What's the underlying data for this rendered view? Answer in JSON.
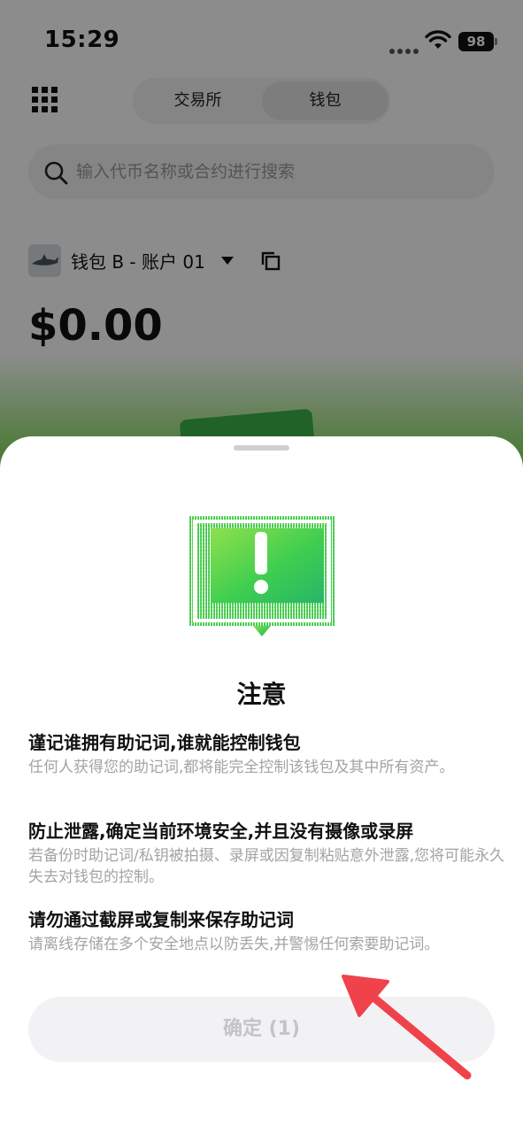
{
  "status_bar": {
    "time": "15:29",
    "battery": "98"
  },
  "header": {
    "tabs": [
      {
        "label": "交易所"
      },
      {
        "label": "钱包"
      }
    ],
    "active_tab": "钱包"
  },
  "search": {
    "placeholder": "输入代币名称或合约进行搜索"
  },
  "wallet": {
    "account_name": "钱包 B - 账户 01",
    "balance": "$0.00"
  },
  "sheet": {
    "title": "注意",
    "items": [
      {
        "title": "谨记谁拥有助记词,谁就能控制钱包",
        "desc": "任何人获得您的助记词,都将能完全控制该钱包及其中所有资产。"
      },
      {
        "title": "防止泄露,确定当前环境安全,并且没有摄像或录屏",
        "desc": "若备份时助记词/私钥被拍摄、录屏或因复制粘贴意外泄露,您将可能永久失去对钱包的控制。"
      },
      {
        "title": "请勿通过截屏或复制来保存助记词",
        "desc": "请离线存储在多个安全地点以防丢失,并警惕任何索要助记词。"
      }
    ],
    "confirm_label": "确定 (1)"
  },
  "colors": {
    "accent_green": "#3fce4f",
    "annotation_arrow": "#f0424a"
  },
  "icons": [
    "grid-icon",
    "search-icon",
    "copy-icon",
    "wifi-icon",
    "warning-illustration"
  ]
}
